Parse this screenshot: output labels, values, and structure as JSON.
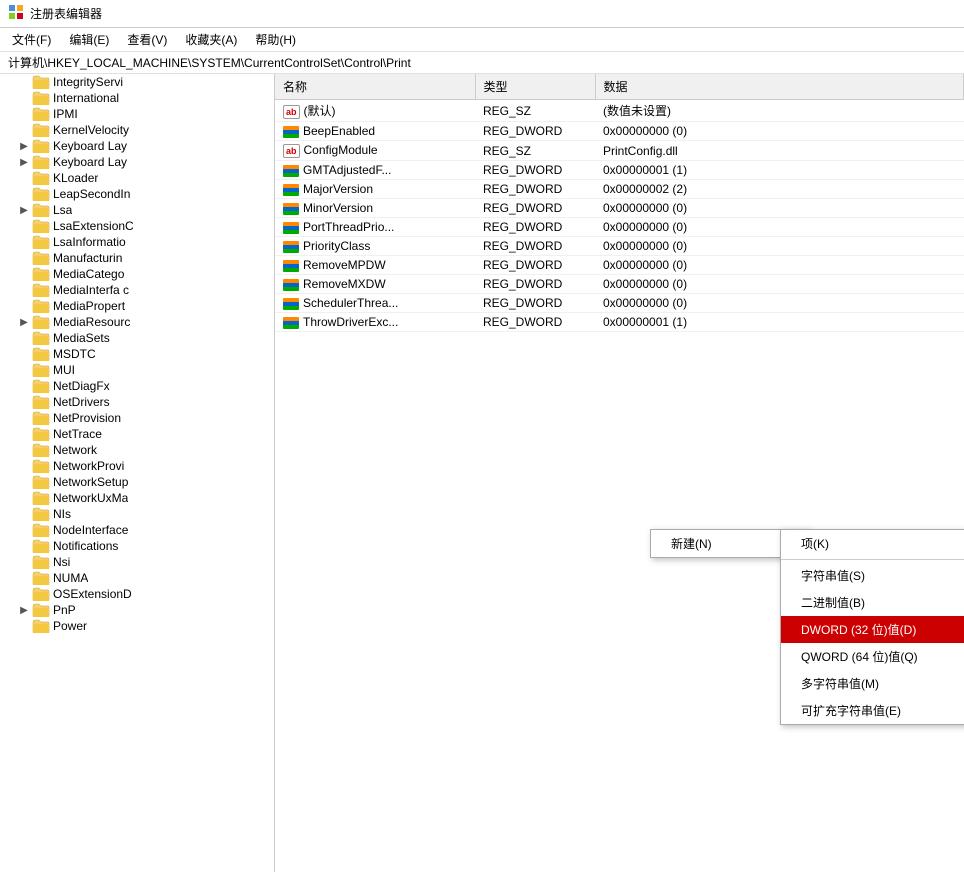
{
  "titleBar": {
    "icon": "registry-icon",
    "title": "注册表编辑器"
  },
  "menuBar": {
    "items": [
      {
        "label": "文件(F)"
      },
      {
        "label": "编辑(E)"
      },
      {
        "label": "查看(V)"
      },
      {
        "label": "收藏夹(A)"
      },
      {
        "label": "帮助(H)"
      }
    ]
  },
  "breadcrumb": "计算机\\HKEY_LOCAL_MACHINE\\SYSTEM\\CurrentControlSet\\Control\\Print",
  "treeItems": [
    {
      "label": "IntegrityServi",
      "indent": 2,
      "hasArrow": false,
      "arrow": ""
    },
    {
      "label": "International",
      "indent": 2,
      "hasArrow": false,
      "arrow": ""
    },
    {
      "label": "IPMI",
      "indent": 2,
      "hasArrow": false,
      "arrow": ""
    },
    {
      "label": "KernelVelocity",
      "indent": 2,
      "hasArrow": false,
      "arrow": ""
    },
    {
      "label": "Keyboard Lay",
      "indent": 2,
      "hasArrow": true,
      "arrow": ">"
    },
    {
      "label": "Keyboard Lay",
      "indent": 2,
      "hasArrow": true,
      "arrow": ">"
    },
    {
      "label": "KLoader",
      "indent": 2,
      "hasArrow": false,
      "arrow": ""
    },
    {
      "label": "LeapSecondIn",
      "indent": 2,
      "hasArrow": false,
      "arrow": ""
    },
    {
      "label": "Lsa",
      "indent": 2,
      "hasArrow": true,
      "arrow": ">"
    },
    {
      "label": "LsaExtensionC",
      "indent": 2,
      "hasArrow": false,
      "arrow": ""
    },
    {
      "label": "LsaInformatio",
      "indent": 2,
      "hasArrow": false,
      "arrow": ""
    },
    {
      "label": "Manufacturin",
      "indent": 2,
      "hasArrow": false,
      "arrow": ""
    },
    {
      "label": "MediaCatego",
      "indent": 2,
      "hasArrow": false,
      "arrow": ""
    },
    {
      "label": "MediaInterfa c",
      "indent": 2,
      "hasArrow": false,
      "arrow": ""
    },
    {
      "label": "MediaPropert",
      "indent": 2,
      "hasArrow": false,
      "arrow": ""
    },
    {
      "label": "MediaResourc",
      "indent": 2,
      "hasArrow": true,
      "arrow": ">"
    },
    {
      "label": "MediaSets",
      "indent": 2,
      "hasArrow": false,
      "arrow": ""
    },
    {
      "label": "MSDTC",
      "indent": 2,
      "hasArrow": false,
      "arrow": ""
    },
    {
      "label": "MUI",
      "indent": 2,
      "hasArrow": false,
      "arrow": ""
    },
    {
      "label": "NetDiagFx",
      "indent": 2,
      "hasArrow": false,
      "arrow": ""
    },
    {
      "label": "NetDrivers",
      "indent": 2,
      "hasArrow": false,
      "arrow": ""
    },
    {
      "label": "NetProvision",
      "indent": 2,
      "hasArrow": false,
      "arrow": ""
    },
    {
      "label": "NetTrace",
      "indent": 2,
      "hasArrow": false,
      "arrow": ""
    },
    {
      "label": "Network",
      "indent": 2,
      "hasArrow": false,
      "arrow": ""
    },
    {
      "label": "NetworkProvi",
      "indent": 2,
      "hasArrow": false,
      "arrow": ""
    },
    {
      "label": "NetworkSetup",
      "indent": 2,
      "hasArrow": false,
      "arrow": ""
    },
    {
      "label": "NetworkUxMa",
      "indent": 2,
      "hasArrow": false,
      "arrow": ""
    },
    {
      "label": "NIs",
      "indent": 2,
      "hasArrow": false,
      "arrow": ""
    },
    {
      "label": "NodeInterface",
      "indent": 2,
      "hasArrow": false,
      "arrow": ""
    },
    {
      "label": "Notifications",
      "indent": 2,
      "hasArrow": false,
      "arrow": ""
    },
    {
      "label": "Nsi",
      "indent": 2,
      "hasArrow": false,
      "arrow": ""
    },
    {
      "label": "NUMA",
      "indent": 2,
      "hasArrow": false,
      "arrow": ""
    },
    {
      "label": "OSExtensionD",
      "indent": 2,
      "hasArrow": false,
      "arrow": ""
    },
    {
      "label": "PnP",
      "indent": 2,
      "hasArrow": true,
      "arrow": ">"
    },
    {
      "label": "Power",
      "indent": 2,
      "hasArrow": false,
      "arrow": ""
    }
  ],
  "tableHeaders": [
    "名称",
    "类型",
    "数据"
  ],
  "tableRows": [
    {
      "icon": "ab",
      "name": "(默认)",
      "type": "REG_SZ",
      "data": "(数值未设置)"
    },
    {
      "icon": "dword",
      "name": "BeepEnabled",
      "type": "REG_DWORD",
      "data": "0x00000000 (0)"
    },
    {
      "icon": "ab",
      "name": "ConfigModule",
      "type": "REG_SZ",
      "data": "PrintConfig.dll"
    },
    {
      "icon": "dword",
      "name": "GMTAdjustedF...",
      "type": "REG_DWORD",
      "data": "0x00000001 (1)"
    },
    {
      "icon": "dword",
      "name": "MajorVersion",
      "type": "REG_DWORD",
      "data": "0x00000002 (2)"
    },
    {
      "icon": "dword",
      "name": "MinorVersion",
      "type": "REG_DWORD",
      "data": "0x00000000 (0)"
    },
    {
      "icon": "dword",
      "name": "PortThreadPrio...",
      "type": "REG_DWORD",
      "data": "0x00000000 (0)"
    },
    {
      "icon": "dword",
      "name": "PriorityClass",
      "type": "REG_DWORD",
      "data": "0x00000000 (0)"
    },
    {
      "icon": "dword",
      "name": "RemoveMPDW",
      "type": "REG_DWORD",
      "data": "0x00000000 (0)"
    },
    {
      "icon": "dword",
      "name": "RemoveMXDW",
      "type": "REG_DWORD",
      "data": "0x00000000 (0)"
    },
    {
      "icon": "dword",
      "name": "SchedulerThrea...",
      "type": "REG_DWORD",
      "data": "0x00000000 (0)"
    },
    {
      "icon": "dword",
      "name": "ThrowDriverExc...",
      "type": "REG_DWORD",
      "data": "0x00000001 (1)"
    }
  ],
  "contextMenu": {
    "newLabel": "新建(N)",
    "arrow": ">",
    "submenu": {
      "items": [
        {
          "label": "项(K)",
          "highlighted": false
        },
        {
          "label": "字符串值(S)",
          "highlighted": false
        },
        {
          "label": "二进制值(B)",
          "highlighted": false
        },
        {
          "label": "DWORD (32 位)值(D)",
          "highlighted": true
        },
        {
          "label": "QWORD (64 位)值(Q)",
          "highlighted": false
        },
        {
          "label": "多字符串值(M)",
          "highlighted": false
        },
        {
          "label": "可扩充字符串值(E)",
          "highlighted": false
        }
      ]
    }
  }
}
